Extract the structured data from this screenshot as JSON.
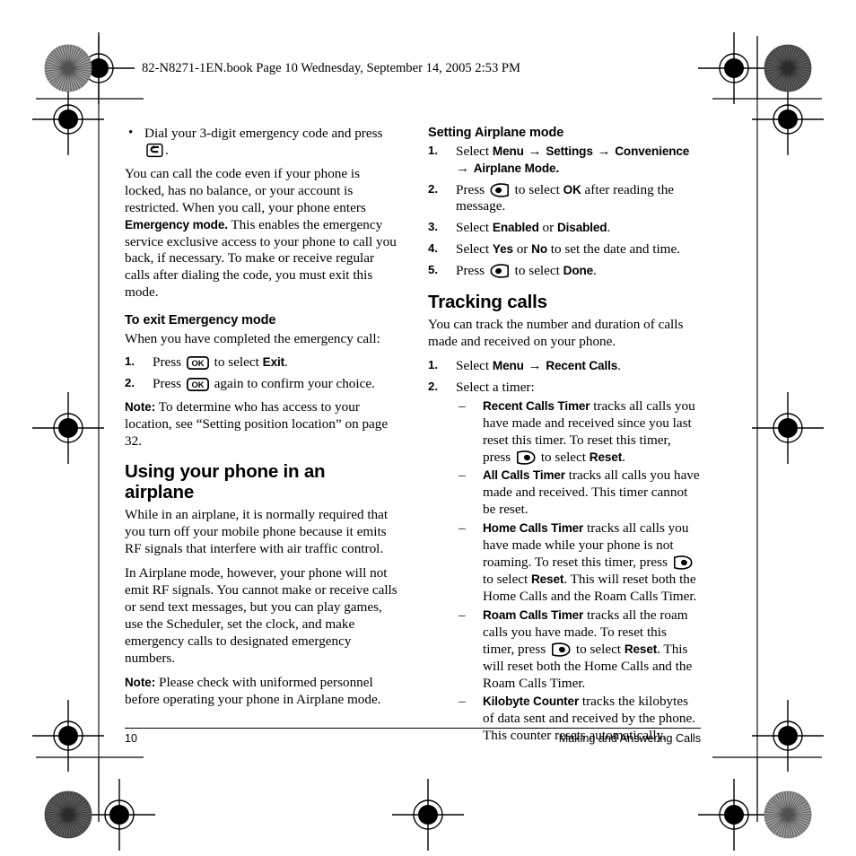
{
  "book_header": "82-N8271-1EN.book  Page 10  Wednesday, September 14, 2005  2:53 PM",
  "footer": {
    "page_number": "10",
    "section_title": "Making and Answering Calls"
  },
  "left_column": {
    "emergency_bullet": {
      "bullet_char": "•",
      "text_before_icon": "Dial  your 3-digit emergency code and press",
      "icon": "send-key-icon",
      "text_after_icon": "."
    },
    "emergency_paragraph_1": "You can call the code even if your phone is locked, has no balance, or your account is restricted. When you call, your phone enters ",
    "emergency_mode_bold": "Emergency mode.",
    "emergency_paragraph_2": " This enables the emergency service exclusive access to your phone to call you back, if necessary. To make or receive regular calls after dialing the code, you must exit this mode.",
    "exit_heading": "To exit Emergency mode",
    "exit_intro": "When you have completed the emergency call:",
    "exit_steps": [
      {
        "num": "1.",
        "before": "Press",
        "icon": "ok-key-icon",
        "middle": "to select ",
        "bold": "Exit",
        "after": "."
      },
      {
        "num": "2.",
        "before": "Press",
        "icon": "ok-key-icon",
        "middle": "again to confirm your choice.",
        "bold": "",
        "after": ""
      }
    ],
    "note_1": {
      "label": "Note:",
      "text": "  To determine who has access to your location, see “Setting position location” on page 32."
    },
    "airplane_heading": "Using your phone in an airplane",
    "airplane_paragraph_1": "While in an airplane, it is normally required that you turn off your mobile phone because it emits RF signals that interfere with air traffic control.",
    "airplane_paragraph_2": "In Airplane mode, however, your phone will not emit RF signals. You cannot make or receive calls or send text messages, but you can play games, use the Scheduler, set the clock, and make emergency calls to designated emergency numbers.",
    "note_2": {
      "label": "Note:",
      "text": "  Please check with uniformed personnel before operating your phone in Airplane mode."
    }
  },
  "right_column": {
    "setting_heading": "Setting Airplane mode",
    "setting_steps": [
      {
        "num": "1.",
        "parts": [
          {
            "type": "text",
            "value": "Select "
          },
          {
            "type": "bold",
            "value": "Menu"
          },
          {
            "type": "arrow",
            "value": "→"
          },
          {
            "type": "bold",
            "value": "Settings"
          },
          {
            "type": "arrow",
            "value": "→"
          },
          {
            "type": "bold",
            "value": "Convenience"
          },
          {
            "type": "arrow",
            "value": "→"
          },
          {
            "type": "bold",
            "value": "Airplane Mode."
          }
        ]
      },
      {
        "num": "2.",
        "parts": [
          {
            "type": "text",
            "value": "Press "
          },
          {
            "type": "icon",
            "value": "softkey-left-icon"
          },
          {
            "type": "text",
            "value": " to select "
          },
          {
            "type": "bold",
            "value": "OK"
          },
          {
            "type": "text",
            "value": " after reading the message."
          }
        ]
      },
      {
        "num": "3.",
        "parts": [
          {
            "type": "text",
            "value": "Select "
          },
          {
            "type": "bold",
            "value": "Enabled"
          },
          {
            "type": "text",
            "value": " or "
          },
          {
            "type": "bold",
            "value": "Disabled"
          },
          {
            "type": "text",
            "value": "."
          }
        ]
      },
      {
        "num": "4.",
        "parts": [
          {
            "type": "text",
            "value": "Select "
          },
          {
            "type": "bold",
            "value": "Yes"
          },
          {
            "type": "text",
            "value": " or "
          },
          {
            "type": "bold",
            "value": "No"
          },
          {
            "type": "text",
            "value": " to set the date and time."
          }
        ]
      },
      {
        "num": "5.",
        "parts": [
          {
            "type": "text",
            "value": "Press "
          },
          {
            "type": "icon",
            "value": "softkey-left-icon"
          },
          {
            "type": "text",
            "value": " to select "
          },
          {
            "type": "bold",
            "value": "Done"
          },
          {
            "type": "text",
            "value": "."
          }
        ]
      }
    ],
    "tracking_heading": "Tracking calls",
    "tracking_intro": "You can track the number and duration of calls made and received on your phone.",
    "tracking_step_1": {
      "num": "1.",
      "parts": [
        {
          "type": "text",
          "value": "Select "
        },
        {
          "type": "bold",
          "value": "Menu"
        },
        {
          "type": "arrow",
          "value": "→"
        },
        {
          "type": "bold",
          "value": "Recent Calls"
        },
        {
          "type": "text",
          "value": "."
        }
      ]
    },
    "tracking_step_2": {
      "num": "2.",
      "text": "Select a timer:"
    },
    "timers": [
      {
        "dash": "–",
        "name": "Recent Calls Timer",
        "parts": [
          {
            "type": "text",
            "value": " tracks all calls you have made and received since you last reset this timer. To reset this timer, press "
          },
          {
            "type": "icon",
            "value": "softkey-right-icon"
          },
          {
            "type": "text",
            "value": " to select "
          },
          {
            "type": "bold",
            "value": "Reset"
          },
          {
            "type": "text",
            "value": "."
          }
        ]
      },
      {
        "dash": "–",
        "name": "All Calls Timer",
        "parts": [
          {
            "type": "text",
            "value": " tracks all calls you have made and received. This timer cannot be reset."
          }
        ]
      },
      {
        "dash": "–",
        "name": "Home Calls Timer",
        "parts": [
          {
            "type": "text",
            "value": " tracks all calls you have made while your phone is not roaming. To reset this timer, press "
          },
          {
            "type": "icon",
            "value": "softkey-right-icon"
          },
          {
            "type": "text",
            "value": " to select "
          },
          {
            "type": "bold",
            "value": "Reset"
          },
          {
            "type": "text",
            "value": ". This will reset both the Home Calls and the Roam Calls Timer."
          }
        ]
      },
      {
        "dash": "–",
        "name": "Roam Calls Timer",
        "parts": [
          {
            "type": "text",
            "value": " tracks all the roam calls you have made. To reset this timer, press "
          },
          {
            "type": "icon",
            "value": "softkey-right-icon"
          },
          {
            "type": "text",
            "value": " to select "
          },
          {
            "type": "bold",
            "value": "Reset"
          },
          {
            "type": "text",
            "value": ". This will reset both the Home Calls and the Roam Calls Timer."
          }
        ]
      },
      {
        "dash": "–",
        "name": "Kilobyte Counter",
        "parts": [
          {
            "type": "text",
            "value": " tracks the kilobytes of data sent and received by the phone. This counter resets automatically."
          }
        ]
      }
    ]
  },
  "prepress_marks": {
    "registration_targets": "crosshair-registration-target",
    "density_patches": "starburst-density-patch",
    "colors": {
      "ink": "#000000",
      "paper": "#ffffff",
      "patch_light": "#b9b9b9",
      "patch_dark": "#6e6e6e"
    }
  }
}
